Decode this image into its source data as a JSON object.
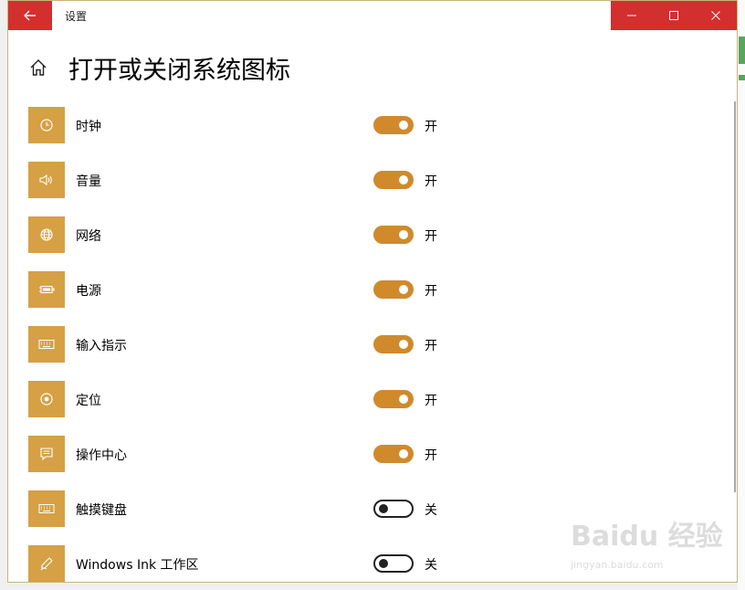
{
  "window": {
    "title": "设置"
  },
  "page": {
    "title": "打开或关闭系统图标"
  },
  "items": [
    {
      "label": "时钟",
      "state": "开",
      "on": true,
      "icon": "clock-icon"
    },
    {
      "label": "音量",
      "state": "开",
      "on": true,
      "icon": "volume-icon"
    },
    {
      "label": "网络",
      "state": "开",
      "on": true,
      "icon": "globe-icon"
    },
    {
      "label": "电源",
      "state": "开",
      "on": true,
      "icon": "battery-icon"
    },
    {
      "label": "输入指示",
      "state": "开",
      "on": true,
      "icon": "keyboard-icon"
    },
    {
      "label": "定位",
      "state": "开",
      "on": true,
      "icon": "location-icon"
    },
    {
      "label": "操作中心",
      "state": "开",
      "on": true,
      "icon": "action-center-icon"
    },
    {
      "label": "触摸键盘",
      "state": "关",
      "on": false,
      "icon": "keyboard-icon"
    },
    {
      "label": "Windows Ink 工作区",
      "state": "关",
      "on": false,
      "icon": "pen-icon"
    }
  ],
  "watermark": {
    "text": "Baidu 经验",
    "url": "jingyan.baidu.com"
  },
  "colors": {
    "accent": "#d08a2c",
    "icon_bg": "#d6a044",
    "titlebar_red": "#d32f2f"
  }
}
